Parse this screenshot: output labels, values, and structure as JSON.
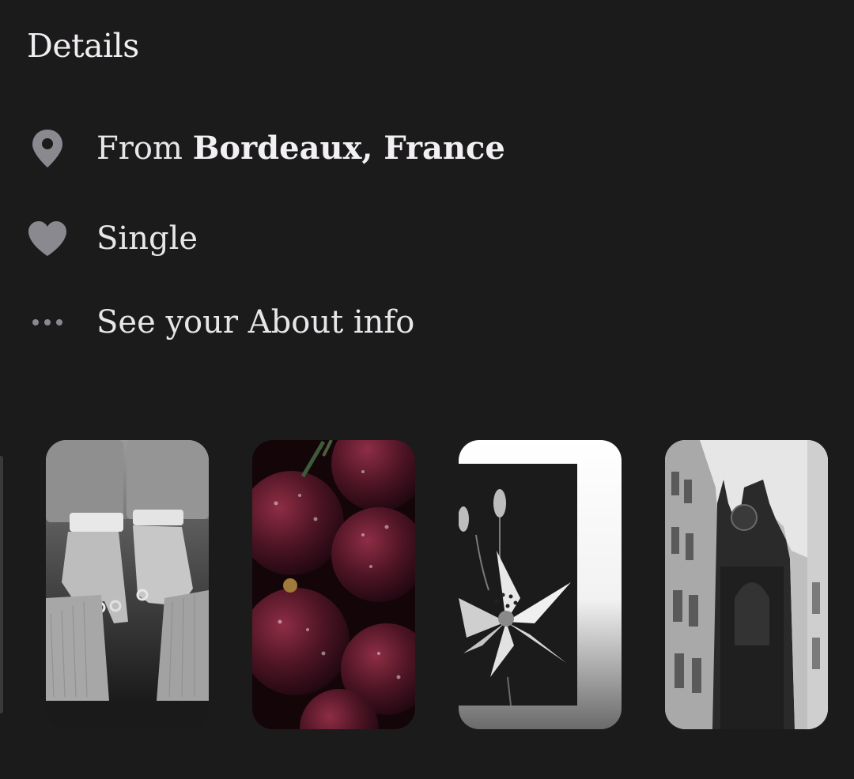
{
  "details": {
    "title": "Details",
    "items": [
      {
        "icon": "location-pin-icon",
        "prefix": "From",
        "value": "Bordeaux, France"
      },
      {
        "icon": "heart-icon",
        "text": "Single"
      },
      {
        "icon": "more-dots-icon",
        "text": "See your About info"
      }
    ]
  },
  "photos": [
    {
      "subject": "hands-with-rings-photo"
    },
    {
      "subject": "cherries-photo"
    },
    {
      "subject": "lily-photo"
    },
    {
      "subject": "gothic-building-photo"
    }
  ],
  "colors": {
    "background": "#1c1b1c",
    "text": "#e9e7ea",
    "icon": "#8a8990"
  }
}
